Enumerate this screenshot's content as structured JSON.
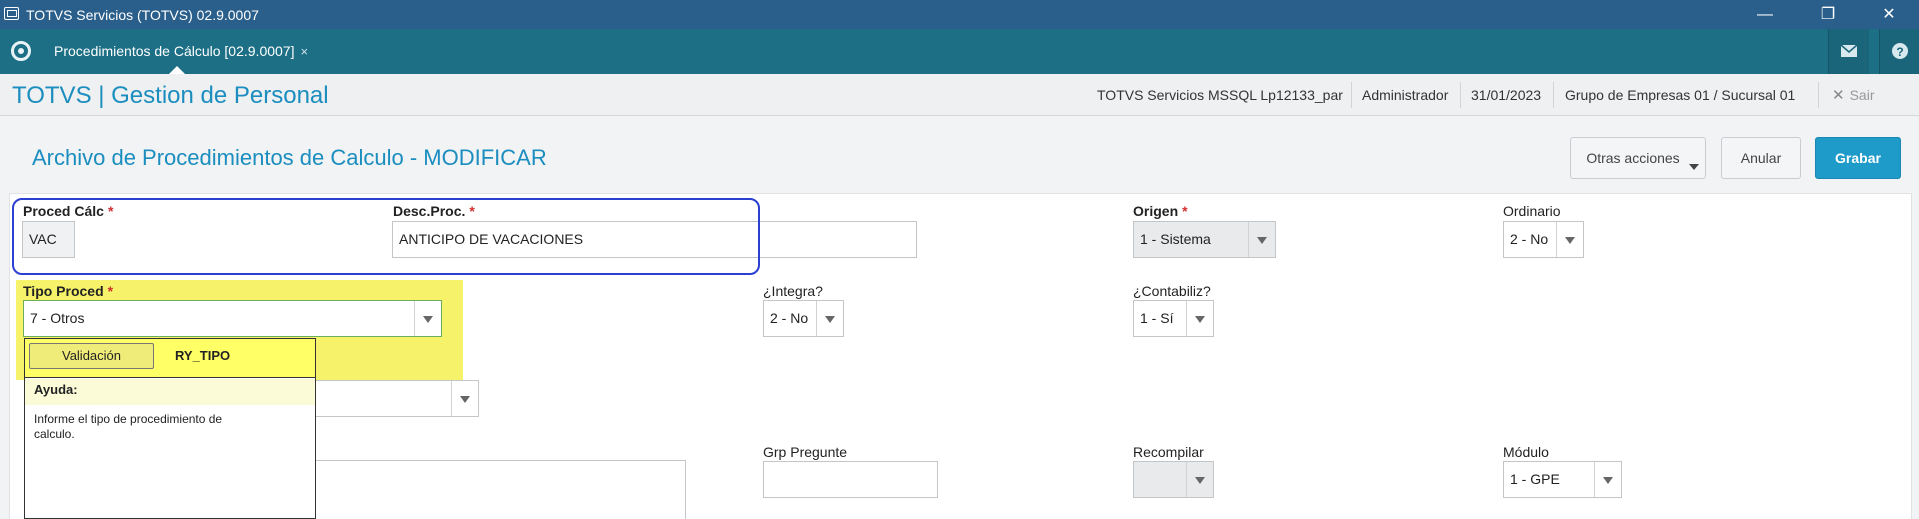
{
  "window": {
    "title": "TOTVS Servicios (TOTVS) 02.9.0007"
  },
  "tabs": [
    {
      "label": "Procedimientos de Cálculo [02.9.0007]",
      "close": "×"
    }
  ],
  "header": {
    "brand": "TOTVS | Gestion de Personal",
    "environment": "TOTVS Servicios MSSQL Lp12133_par",
    "user": "Administrador",
    "date": "31/01/2023",
    "company": "Grupo de Empresas 01 / Sucursal 01",
    "exit_label": "Sair"
  },
  "page": {
    "title": "Archivo de Procedimientos de Calculo - MODIFICAR"
  },
  "actions": {
    "other": "Otras acciones",
    "cancel": "Anular",
    "save": "Grabar"
  },
  "form": {
    "proced_calc": {
      "label": "Proced Cálc",
      "value": "VAC"
    },
    "desc_proc": {
      "label": "Desc.Proc.",
      "value": "ANTICIPO DE VACACIONES"
    },
    "origen": {
      "label": "Origen",
      "value": "1 - Sistema"
    },
    "ordinario": {
      "label": "Ordinario",
      "value": "2 - No"
    },
    "tipo_proced": {
      "label": "Tipo Proced",
      "value": "7 - Otros"
    },
    "integra": {
      "label": "¿Integra?",
      "value": "2 - No"
    },
    "contabiliz": {
      "label": "¿Contabiliz?",
      "value": "1 - Sí"
    },
    "grp_pregunte": {
      "label": "Grp Pregunte",
      "value": ""
    },
    "recompilar": {
      "label": "Recompilar",
      "value": ""
    },
    "modulo": {
      "label": "Módulo",
      "value": "1 - GPE"
    }
  },
  "help_popup": {
    "validation_button": "Validación",
    "field_code": "RY_TIPO",
    "help_label": "Ayuda:",
    "help_text": "Informe el tipo de procedimiento de calculo."
  },
  "colors": {
    "titlebar": "#2a5f8b",
    "tabbar": "#1d6f86",
    "accent": "#1b8dbf",
    "save_button": "#1e9bc8",
    "highlight": "#f6f36a",
    "frame": "#2b3fd1"
  }
}
